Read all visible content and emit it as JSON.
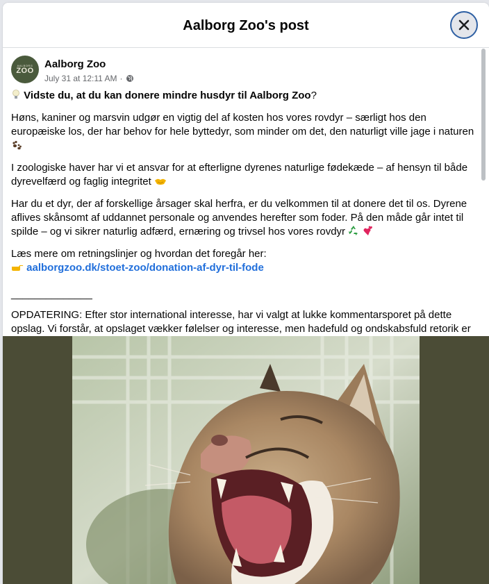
{
  "dialog": {
    "title": "Aalborg Zoo's post"
  },
  "post": {
    "author": "Aalborg Zoo",
    "avatar_small": "AALBORG",
    "avatar_big": "ZOO",
    "timestamp": "July 31 at 12:11 AM",
    "audience_separator": "·",
    "intro_bold": "Vidste du, at du kan donere mindre husdyr til Aalborg Zoo",
    "intro_mark": "?",
    "para1": "Høns, kaniner og marsvin udgør en vigtig del af kosten hos vores rovdyr – særligt hos den europæiske los, der har behov for hele byttedyr, som minder om det, den naturligt ville jage i naturen",
    "para2": "I zoologiske haver har vi et ansvar for at efterligne dyrenes naturlige fødekæde – af hensyn til både dyrevelfærd og faglig integritet",
    "para3": "Har du et dyr, der af forskellige årsager skal herfra, er du velkommen til at donere det til os. Dyrene aflives skånsomt af uddannet personale og anvendes herefter som foder. På den måde går intet til spilde – og vi sikrer naturlig adfærd, ernæring og trivsel hos vores rovdyr",
    "para4": "Læs mere om retningslinjer og hvordan det foregår her:",
    "link": "aalborgzoo.dk/stoet-zoo/donation-af-dyr-til-fode",
    "divider": "______________",
    "update": "OPDATERING: Efter stor international interesse, har vi valgt at lukke kommentarsporet på dette opslag. Vi forstår, at opslaget vækker følelser og interesse, men hadefuld og ondskabsfuld retorik er ikke nødvendig - og vi opfordrer til at bevare den gode tone. Vi uddyber og besvarer gerne spørgsmål i indbakken eller på mail"
  },
  "icons": [
    "close-icon",
    "globe-icon",
    "lightbulb-icon",
    "paw-prints-icon",
    "handshake-icon",
    "recycle-icon",
    "two-hearts-icon",
    "pointing-hand-icon",
    "smiling-face-icon"
  ],
  "colors": {
    "link": "#216fdb",
    "muted": "#65676b",
    "avatar_bg": "#4a5a3c",
    "photo_band": "#4b4c36"
  }
}
